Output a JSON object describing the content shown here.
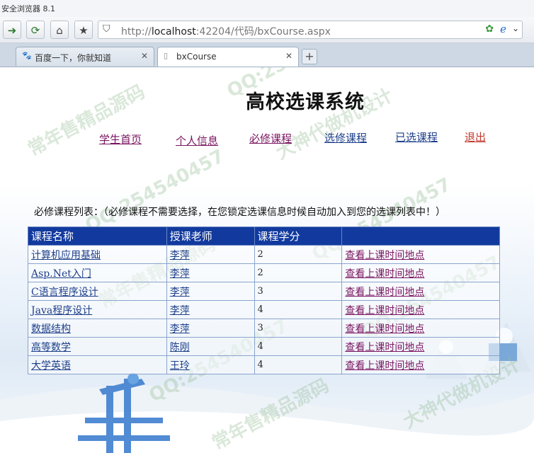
{
  "browser": {
    "title": "安全浏览器 8.1",
    "address": {
      "prefix": "http://",
      "host": "localhost",
      "rest": ":42204/代码/bxCourse.aspx"
    },
    "tabs": [
      {
        "label": "百度一下，你就知道",
        "active": false
      },
      {
        "label": "bxCourse",
        "active": true
      }
    ],
    "new_tab": "+"
  },
  "site": {
    "title": "高校选课系统",
    "nav": [
      {
        "label": "学生首页",
        "color": "#7a1560"
      },
      {
        "label": "个人信息",
        "color": "#7a1560"
      },
      {
        "label": "必修课程",
        "color": "#7a1560"
      },
      {
        "label": "选修课程",
        "color": "#1d3f8a"
      },
      {
        "label": "已选课程",
        "color": "#1d3f8a"
      },
      {
        "label": "退出",
        "color": "#c0392b"
      }
    ]
  },
  "section": {
    "label": "必修课程列表：（必修课程不需要选择，在您锁定选课信息时候自动加入到您的选课列表中！）"
  },
  "table": {
    "headers": [
      "课程名称",
      "授课老师",
      "课程学分",
      ""
    ],
    "rows": [
      {
        "name": "计算机应用基础",
        "teacher": "李萍",
        "credit": "2",
        "action": "查看上课时间地点"
      },
      {
        "name": "Asp.Net入门",
        "teacher": "李萍",
        "credit": "2",
        "action": "查看上课时间地点"
      },
      {
        "name": "C语言程序设计",
        "teacher": "李萍",
        "credit": "3",
        "action": "查看上课时间地点"
      },
      {
        "name": "Java程序设计",
        "teacher": "李萍",
        "credit": "4",
        "action": "查看上课时间地点"
      },
      {
        "name": "数据结构",
        "teacher": "李萍",
        "credit": "3",
        "action": "查看上课时间地点"
      },
      {
        "name": "高等数学",
        "teacher": "陈刚",
        "credit": "4",
        "action": "查看上课时间地点"
      },
      {
        "name": "大学英语",
        "teacher": "王玲",
        "credit": "4",
        "action": "查看上课时间地点"
      }
    ]
  },
  "watermarks": [
    "QQ:254540457",
    "常年售精品源码",
    "大神代做机设计"
  ],
  "colors": {
    "header_bg": "#123a9e",
    "link_blue": "#1d3f8a",
    "link_purple": "#7a1560",
    "logout_red": "#c0392b"
  }
}
